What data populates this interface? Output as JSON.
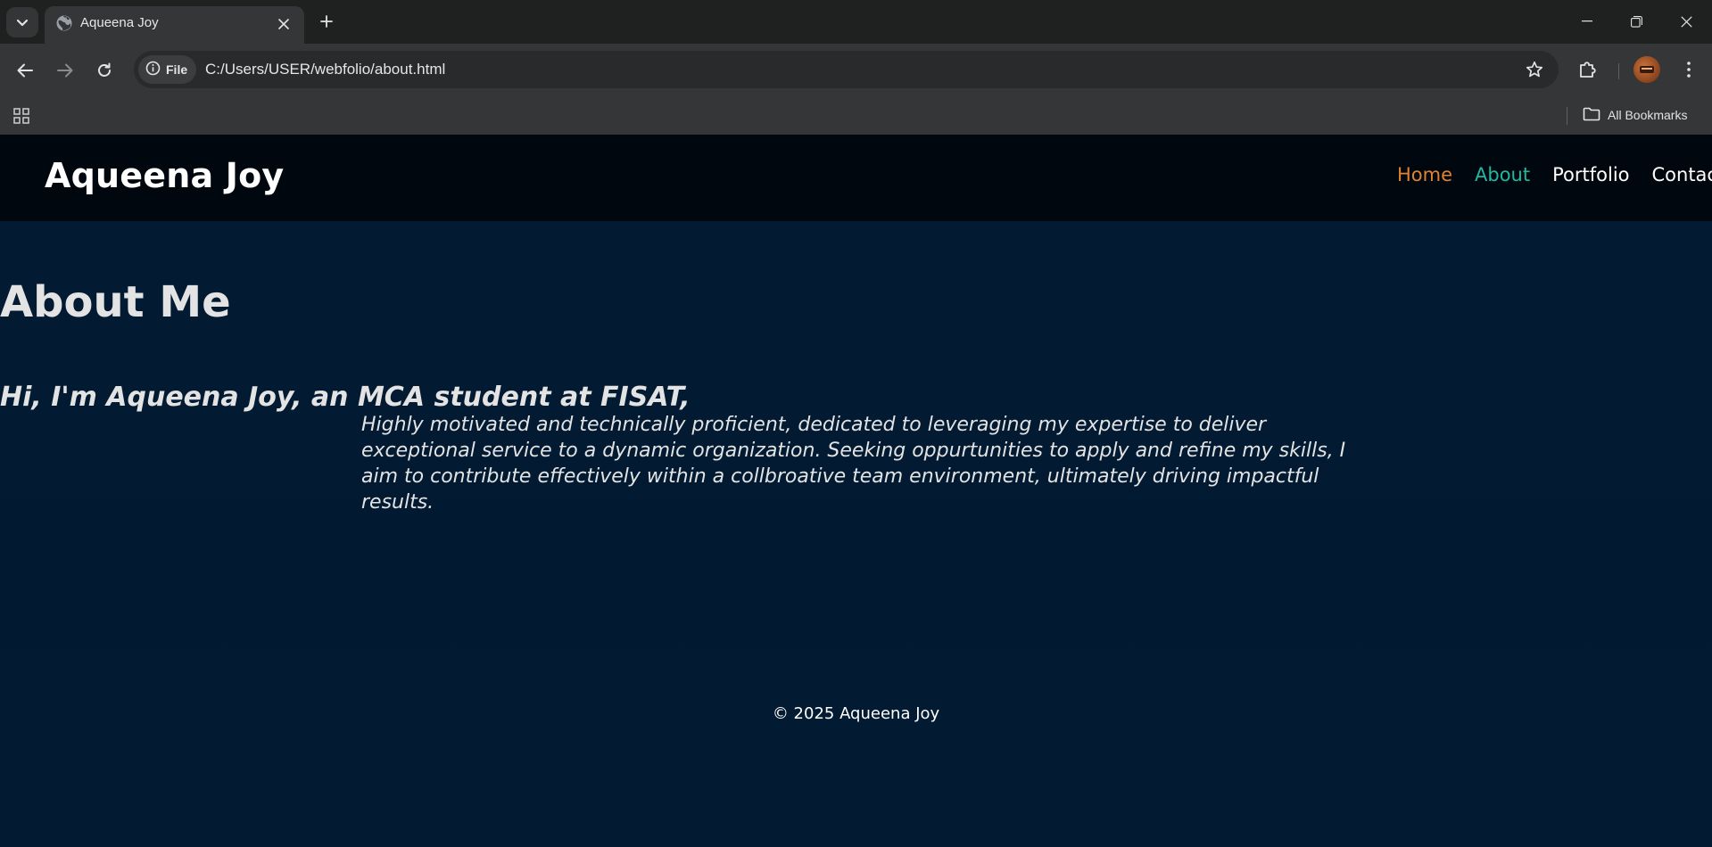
{
  "browser": {
    "tab": {
      "title": "Aqueena Joy"
    },
    "address_bar": {
      "chip_label": "File",
      "url": "C:/Users/USER/webfolio/about.html"
    },
    "bookmarks_bar": {
      "all_bookmarks_label": "All Bookmarks"
    },
    "icons": [
      "tab-search-icon",
      "globe-icon",
      "close-icon",
      "plus-icon",
      "minimize-icon",
      "restore-icon",
      "window-close-icon",
      "back-arrow-icon",
      "forward-arrow-icon",
      "reload-icon",
      "info-icon",
      "star-icon",
      "puzzle-icon",
      "kebab-menu-icon",
      "apps-grid-icon",
      "folder-icon"
    ]
  },
  "site": {
    "logo": "Aqueena Joy",
    "nav": {
      "home": "Home",
      "about": "About",
      "portfolio": "Portfolio",
      "contact": "Contact"
    },
    "colors": {
      "nav_home": "#e0822f",
      "nav_about_active": "#1fb9a2",
      "header_bg": "#01070f",
      "page_bg": "#021a33"
    }
  },
  "about": {
    "heading": "About Me",
    "intro": "Hi, I'm Aqueena Joy, an MCA student at FISAT,",
    "body": "Highly motivated and technically proficient, dedicated to leveraging my expertise to deliver exceptional service to a dynamic organization. Seeking oppurtunities to apply and refine my skills, I aim to contribute effectively within a collbroative team environment, ultimately driving impactful results."
  },
  "footer": {
    "copyright": "© 2025 Aqueena Joy"
  }
}
